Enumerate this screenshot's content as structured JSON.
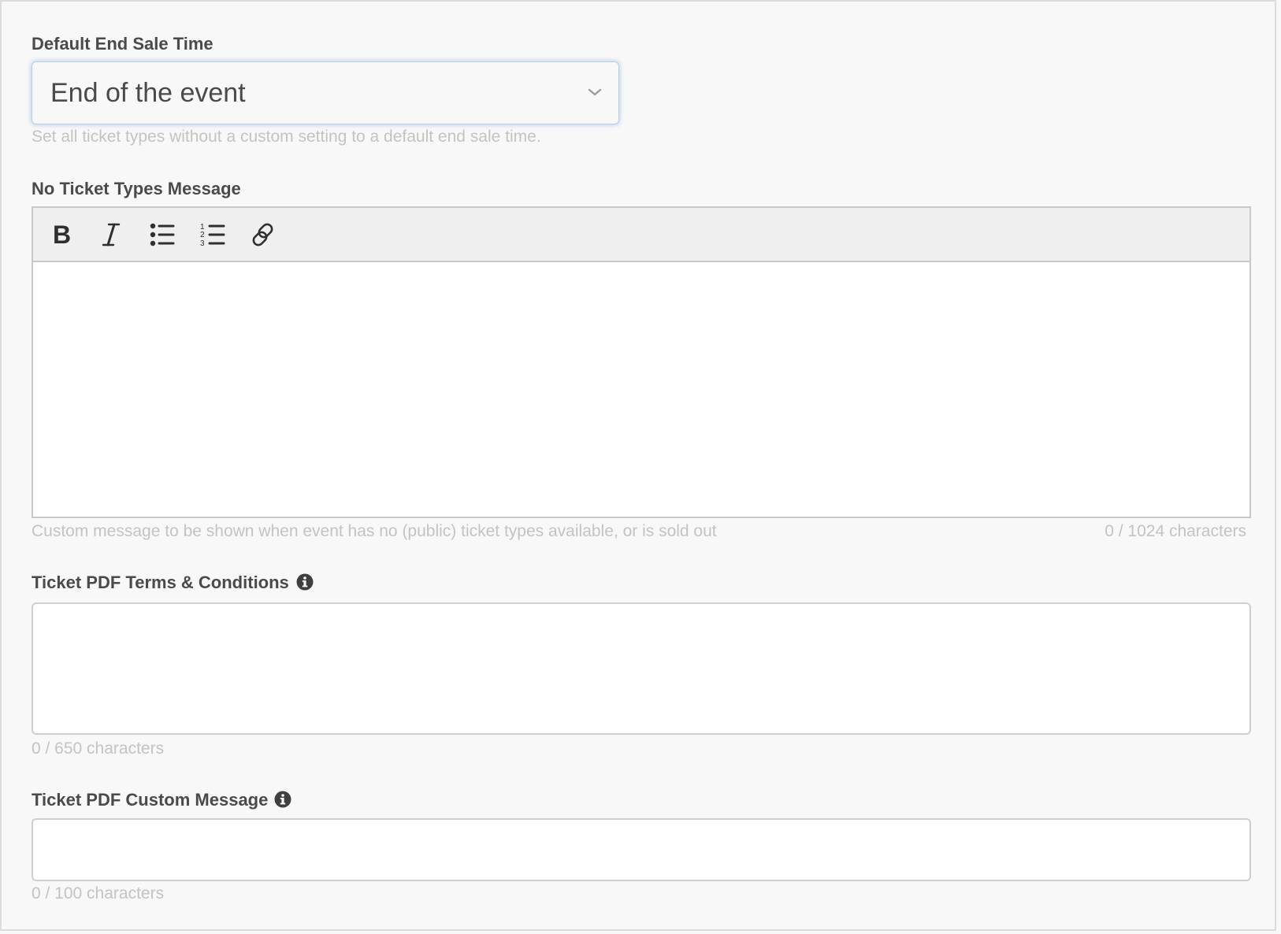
{
  "default_end_sale": {
    "label": "Default End Sale Time",
    "selected_value": "End of the event",
    "help": "Set all ticket types without a custom setting to a default end sale time."
  },
  "no_ticket_message": {
    "label": "No Ticket Types Message",
    "toolbar": {
      "bold": "bold-icon",
      "italic": "italic-icon",
      "bullet_list": "bulleted-list-icon",
      "numbered_list": "numbered-list-icon",
      "link": "link-icon"
    },
    "value": "",
    "help": "Custom message to be shown when event has no (public) ticket types available, or is sold out",
    "counter": "0 / 1024 characters"
  },
  "pdf_terms": {
    "label": "Ticket PDF Terms & Conditions",
    "value": "",
    "counter": "0 / 650 characters"
  },
  "pdf_custom_message": {
    "label": "Ticket PDF Custom Message",
    "value": "",
    "counter": "0 / 100 characters"
  },
  "colors": {
    "label": "#4a4a4a",
    "help": "#c3c3c3",
    "focus": "#b9cde6",
    "border": "#c9c9c9"
  }
}
